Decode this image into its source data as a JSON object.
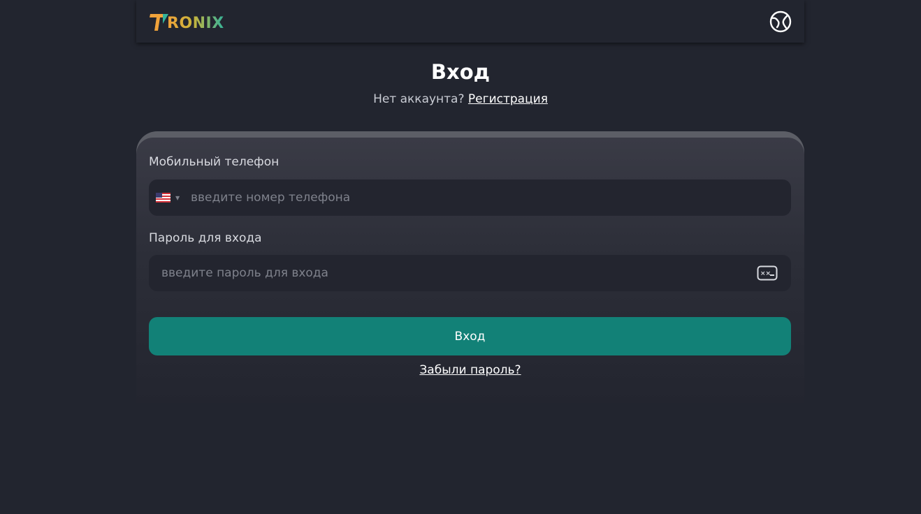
{
  "brand": {
    "logo_text": "RONIX",
    "colors": {
      "orange": "#f0a23a",
      "teal": "#33b39a"
    }
  },
  "header": {
    "language_icon": "globe-icon"
  },
  "page": {
    "title": "Вход",
    "no_account_text": "Нет аккаунта?",
    "register_link": "Регистрация"
  },
  "form": {
    "phone": {
      "label": "Мобильный телефон",
      "placeholder": "введите номер телефона",
      "value": "",
      "country_icon": "us-flag-icon"
    },
    "password": {
      "label": "Пароль для входа",
      "placeholder": "введите пароль для входа",
      "value": "",
      "toggle_icon": "password-hidden-icon"
    },
    "submit_label": "Вход",
    "forgot_link": "Забыли пароль?",
    "colors": {
      "button": "#128177",
      "background": "#22252f"
    }
  }
}
